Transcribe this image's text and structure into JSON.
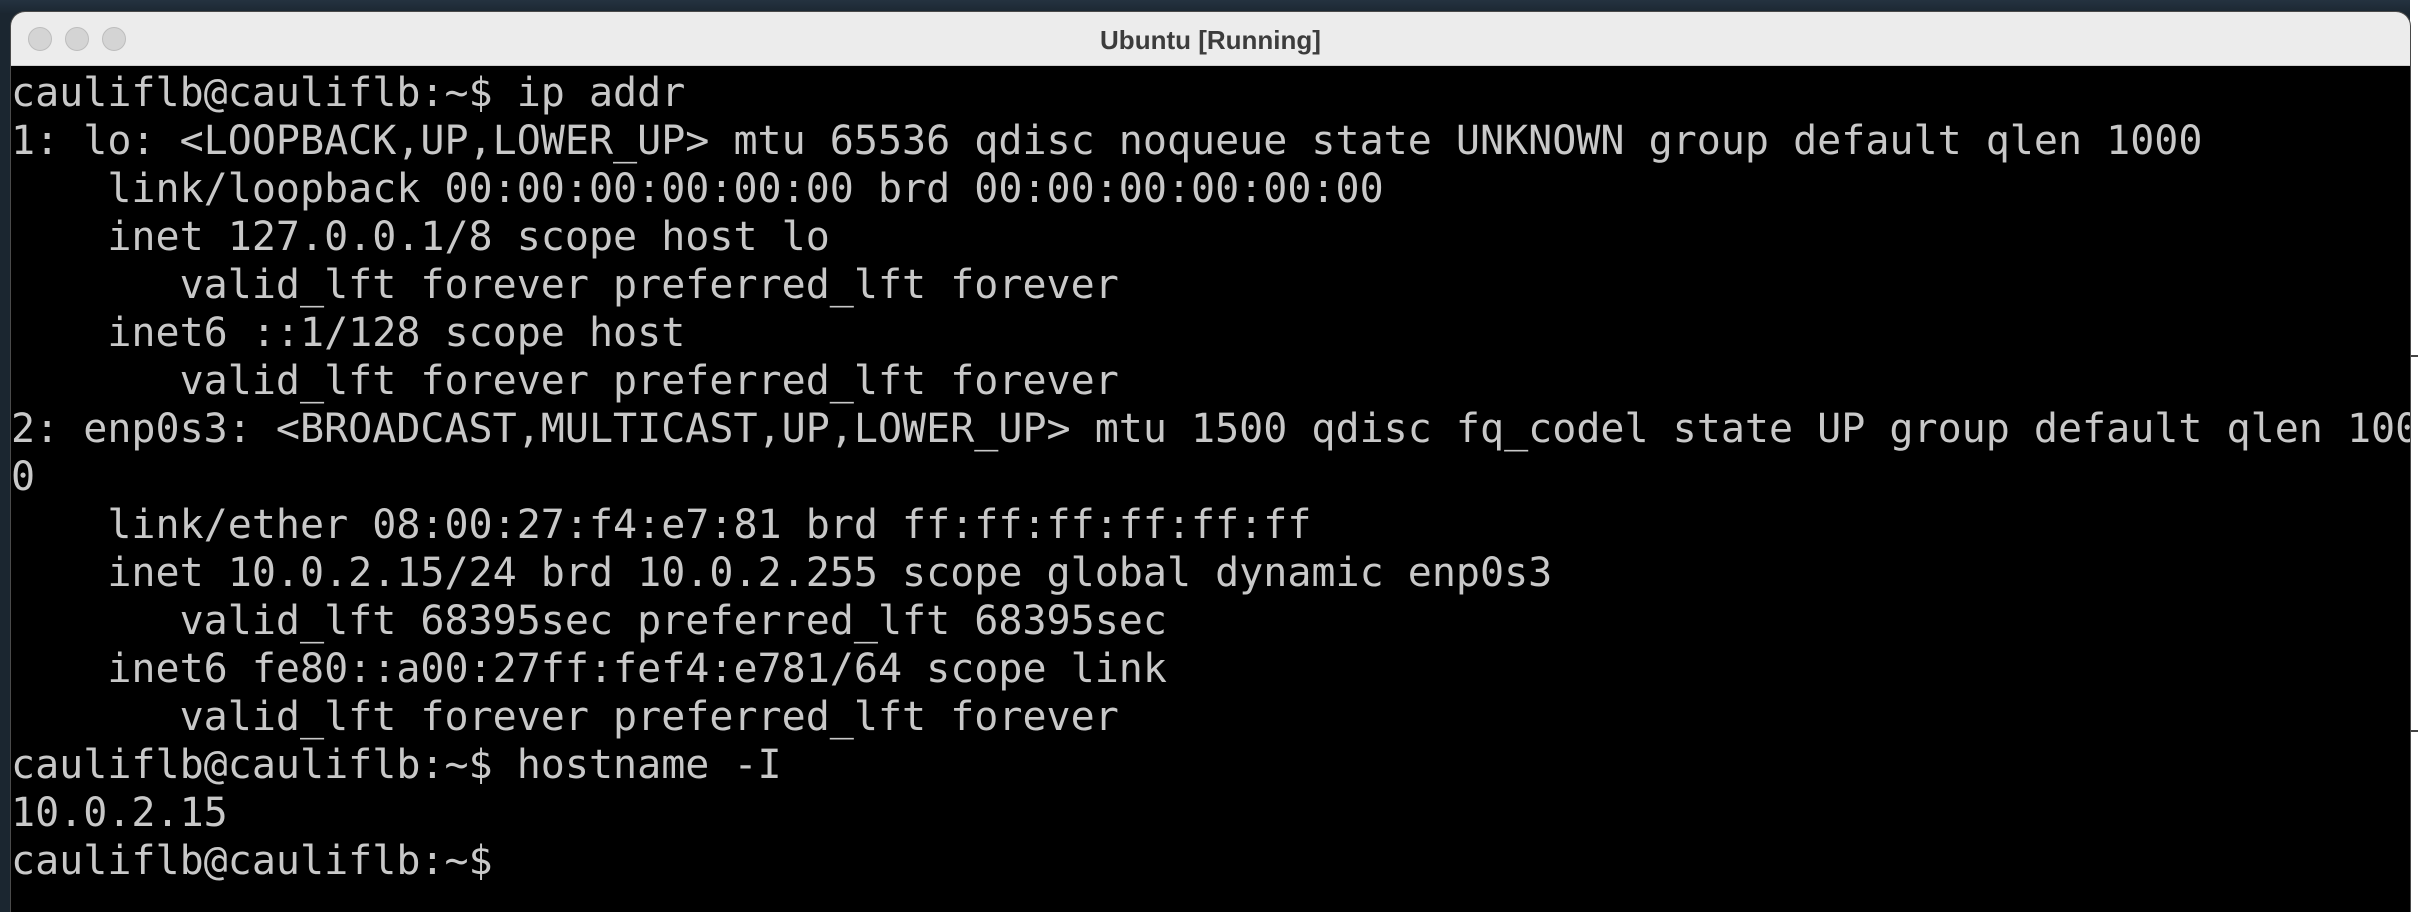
{
  "window": {
    "title": "Ubuntu [Running]"
  },
  "terminal": {
    "lines": [
      "cauliflb@cauliflb:~$ ip addr",
      "1: lo: <LOOPBACK,UP,LOWER_UP> mtu 65536 qdisc noqueue state UNKNOWN group default qlen 1000",
      "    link/loopback 00:00:00:00:00:00 brd 00:00:00:00:00:00",
      "    inet 127.0.0.1/8 scope host lo",
      "       valid_lft forever preferred_lft forever",
      "    inet6 ::1/128 scope host",
      "       valid_lft forever preferred_lft forever",
      "2: enp0s3: <BROADCAST,MULTICAST,UP,LOWER_UP> mtu 1500 qdisc fq_codel state UP group default qlen 100",
      "0",
      "    link/ether 08:00:27:f4:e7:81 brd ff:ff:ff:ff:ff:ff",
      "    inet 10.0.2.15/24 brd 10.0.2.255 scope global dynamic enp0s3",
      "       valid_lft 68395sec preferred_lft 68395sec",
      "    inet6 fe80::a00:27ff:fef4:e781/64 scope link",
      "       valid_lft forever preferred_lft forever",
      "cauliflb@cauliflb:~$ hostname -I",
      "10.0.2.15",
      "cauliflb@cauliflb:~$"
    ]
  },
  "colors": {
    "terminal_bg": "#000000",
    "terminal_fg": "#c8c8c8",
    "titlebar_bg": "#ececec"
  }
}
